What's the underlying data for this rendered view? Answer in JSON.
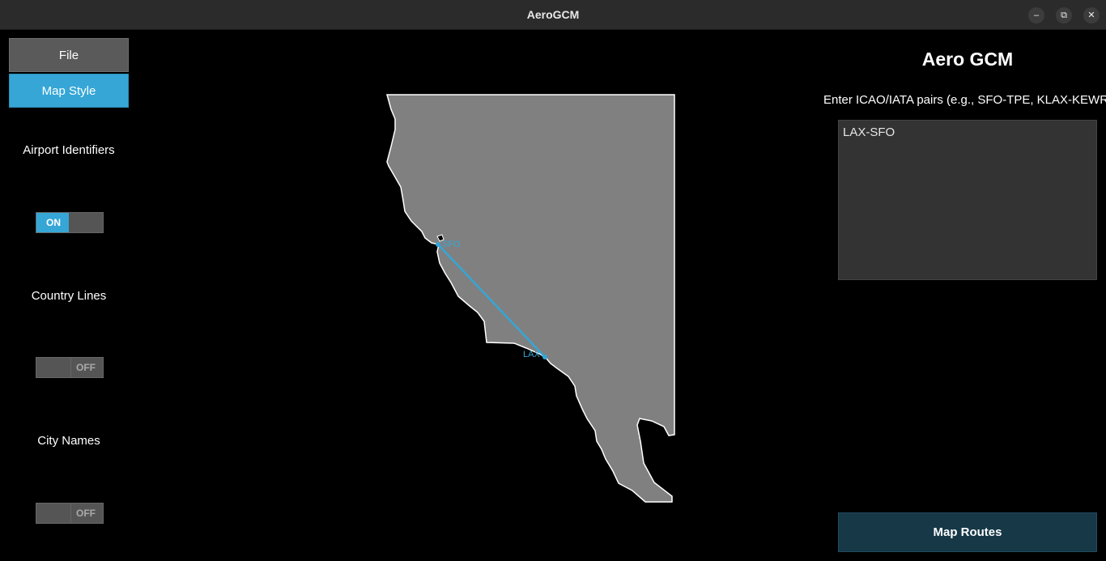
{
  "window": {
    "title": "AeroGCM",
    "controls": [
      {
        "name": "minimize-icon",
        "glyph": "–"
      },
      {
        "name": "maximize-icon",
        "glyph": "⧉"
      },
      {
        "name": "close-icon",
        "glyph": "✕"
      }
    ]
  },
  "sidebar": {
    "file_label": "File",
    "map_style_label": "Map Style",
    "airport_identifiers": {
      "label": "Airport Identifiers",
      "state": "ON"
    },
    "country_lines": {
      "label": "Country Lines",
      "state": "OFF"
    },
    "city_names": {
      "label": "City Names",
      "state": "OFF"
    }
  },
  "map": {
    "route": {
      "from": "LAX",
      "to": "SFO"
    },
    "airport_labels": {
      "from": "LAX",
      "to": "SFO"
    },
    "colors": {
      "land": "#808080",
      "coast": "#ffffff",
      "route": "#36a6d6",
      "background": "#000000"
    }
  },
  "panel": {
    "title": "Aero GCM",
    "hint": "Enter ICAO/IATA pairs (e.g., SFO-TPE, KLAX-KEWR",
    "input_value": "LAX-SFO",
    "map_routes_label": "Map Routes"
  },
  "colors": {
    "accent": "#36a6d6",
    "button_dark": "#163847"
  }
}
